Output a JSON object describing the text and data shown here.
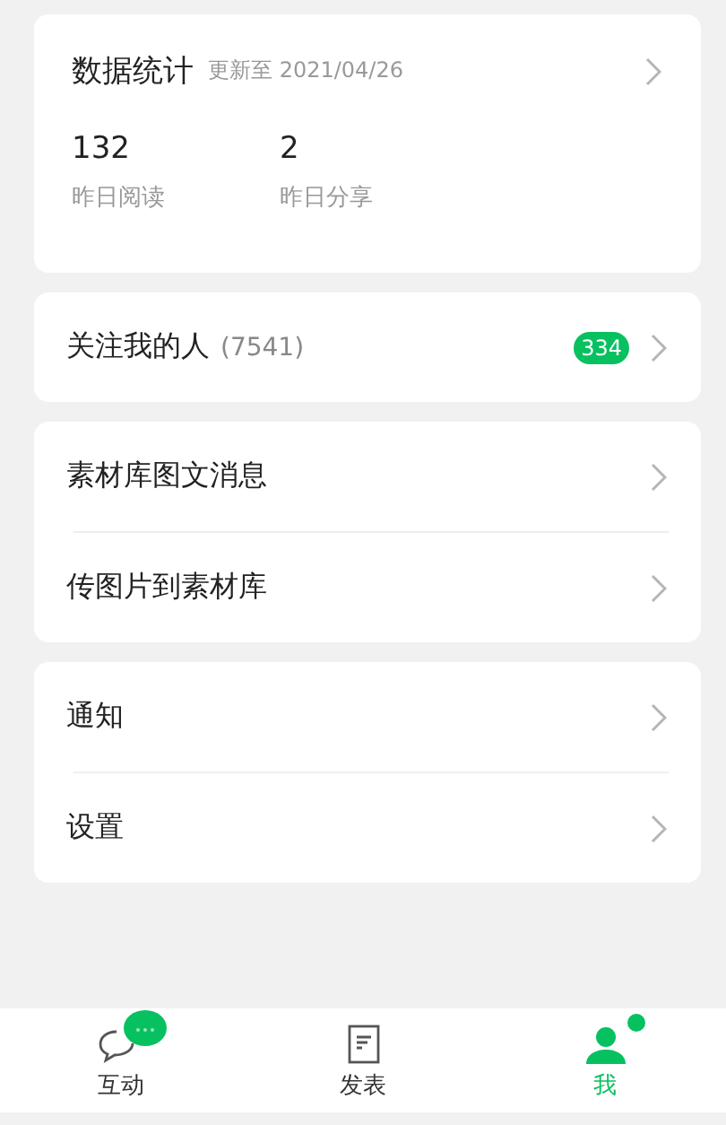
{
  "stats": {
    "title": "数据统计",
    "updated": "更新至 2021/04/26",
    "items": [
      {
        "value": "132",
        "label": "昨日阅读"
      },
      {
        "value": "2",
        "label": "昨日分享"
      }
    ]
  },
  "groups": [
    {
      "rows": [
        {
          "label": "关注我的人",
          "count": "(7541)",
          "badge": "334"
        }
      ]
    },
    {
      "rows": [
        {
          "label": "素材库图文消息"
        },
        {
          "label": "传图片到素材库"
        }
      ]
    },
    {
      "rows": [
        {
          "label": "通知"
        },
        {
          "label": "设置"
        }
      ]
    }
  ],
  "tabs": [
    {
      "label": "互动",
      "kind": "chat",
      "selected": false,
      "dot": true
    },
    {
      "label": "发表",
      "kind": "post",
      "selected": false,
      "dot": false
    },
    {
      "label": "我",
      "kind": "profile",
      "selected": true,
      "dot": true
    }
  ]
}
